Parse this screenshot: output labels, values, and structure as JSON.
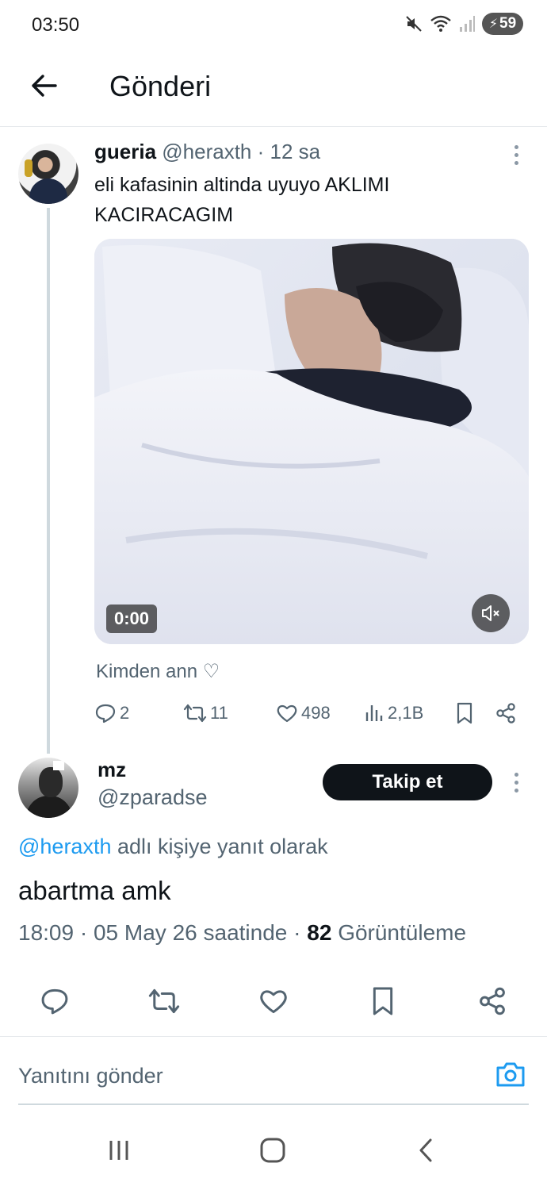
{
  "status_bar": {
    "time": "03:50",
    "battery": "59",
    "icons": [
      "mute-icon",
      "wifi-icon",
      "signal-icon",
      "battery-charging-icon"
    ]
  },
  "header": {
    "title": "Gönderi",
    "back_icon": "arrow-left-icon"
  },
  "parent_tweet": {
    "name": "gueria",
    "handle": "@heraxth",
    "separator": "·",
    "time": "12 sa",
    "text": "eli kafasinin altinda uyuyo AKLIMI KACIRACAGIM",
    "media": {
      "type": "video",
      "timestamp": "0:00",
      "muted": true
    },
    "from_label": "Kimden ann ♡",
    "stats": {
      "replies": "2",
      "retweets": "11",
      "likes": "498",
      "views": "2,1B"
    }
  },
  "reply": {
    "name": "mz",
    "handle": "@zparadse",
    "follow_label": "Takip et",
    "reply_to_mention": "@heraxth",
    "reply_to_suffix": "adlı kişiye yanıt olarak",
    "text": "abartma amk",
    "time": "18:09",
    "separator": "·",
    "date": "05 May 26 saatinde",
    "separator2": "·",
    "views_count": "82",
    "views_label": "Görüntüleme"
  },
  "compose": {
    "placeholder": "Yanıtını gönder"
  },
  "nav": [
    "recent-apps-icon",
    "home-icon",
    "back-icon"
  ],
  "colors": {
    "accent": "#1d9bf0",
    "text_primary": "#0f1419",
    "text_secondary": "#536471",
    "divider": "#e6e9ec",
    "follow_button": "#0f1419"
  }
}
